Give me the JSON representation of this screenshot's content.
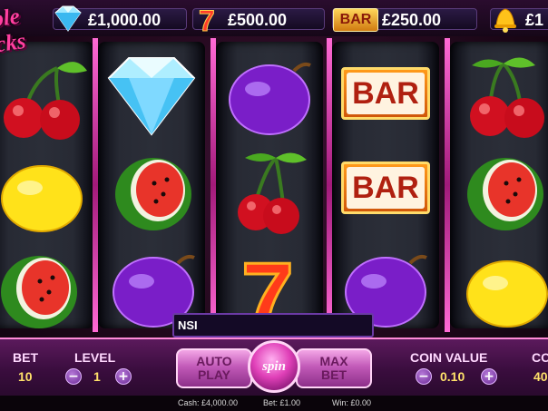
{
  "logo": {
    "line1": "ple",
    "line2": "cks"
  },
  "jackpots": [
    {
      "icon": "diamond-icon",
      "amount": "£1,000.00"
    },
    {
      "icon": "seven-icon",
      "amount": "£500.00"
    },
    {
      "icon": "bar-icon",
      "badge": "BAR",
      "amount": "£250.00"
    },
    {
      "icon": "bell-icon",
      "amount": "£1"
    }
  ],
  "reels": [
    [
      "cherry",
      "lemon",
      "watermelon"
    ],
    [
      "diamond",
      "watermelon",
      "plum"
    ],
    [
      "plum",
      "cherry",
      "seven"
    ],
    [
      "bar",
      "bar",
      "plum"
    ],
    [
      "cherry",
      "watermelon",
      "lemon"
    ]
  ],
  "bar_text": "BAR",
  "seven_text": "7",
  "message": "NSI",
  "controls": {
    "bet_label": "BET",
    "bet_value": "10",
    "level_label": "LEVEL",
    "level_value": "1",
    "auto_play_line1": "AUTO",
    "auto_play_line2": "PLAY",
    "spin_label": "spin",
    "max_bet_line1": "MAX",
    "max_bet_line2": "BET",
    "coin_value_label": "COIN VALUE",
    "coin_value": "0.10",
    "coins_label": "CO",
    "coins_value": "40",
    "minus": "−",
    "plus": "+"
  },
  "status": {
    "cash": "Cash: £4,000.00",
    "bet": "Bet: £1.00",
    "win": "Win: £0.00"
  },
  "colors": {
    "accent_pink": "#ff3fa0",
    "gold": "#ffe16a",
    "purple": "#6b2a96"
  }
}
